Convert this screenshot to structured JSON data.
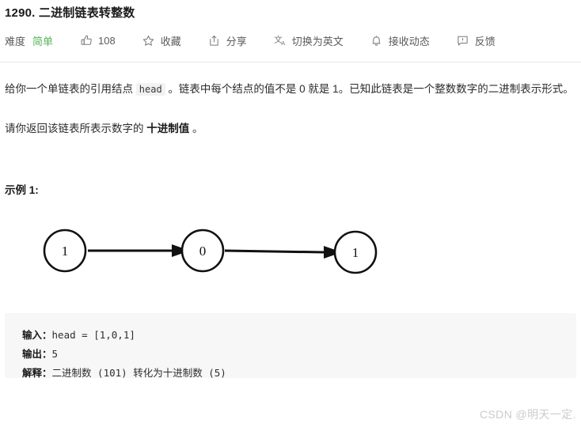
{
  "header": {
    "title": "1290. 二进制链表转整数"
  },
  "toolbar": {
    "difficulty_label": "难度",
    "difficulty_value": "简单",
    "difficulty_color": "#56b356",
    "like_icon": "thumbs-up-icon",
    "like_count": "108",
    "favorite_icon": "star-icon",
    "favorite_label": "收藏",
    "share_icon": "share-icon",
    "share_label": "分享",
    "translate_icon": "translate-icon",
    "translate_label": "切换为英文",
    "subscribe_icon": "bell-icon",
    "subscribe_label": "接收动态",
    "feedback_icon": "feedback-icon",
    "feedback_label": "反馈"
  },
  "description": {
    "para1_before": "给你一个单链表的引用结点 ",
    "para1_code": "head",
    "para1_after": " 。链表中每个结点的值不是 0 就是 1。已知此链表是一个整数数字的二进制表示形式。",
    "para2_before": "请你返回该链表所表示数字的 ",
    "para2_bold": "十进制值",
    "para2_after": " 。"
  },
  "example": {
    "title": "示例 1:",
    "diagram": {
      "type": "linked-list",
      "nodes": [
        "1",
        "0",
        "1"
      ]
    },
    "code": {
      "input_key": "输入：",
      "input_value": "head = [1,0,1]",
      "output_key": "输出：",
      "output_value": "5",
      "explain_key": "解释：",
      "explain_value": "二进制数 (101) 转化为十进制数 (5)"
    }
  },
  "watermark": {
    "text": "CSDN @明天一定."
  }
}
